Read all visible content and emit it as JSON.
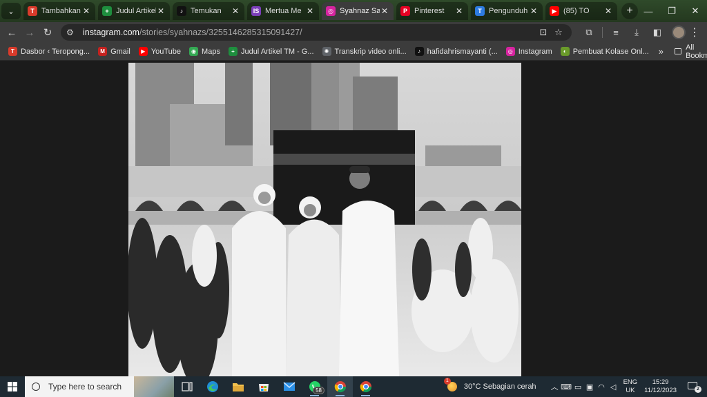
{
  "tabs": [
    {
      "title": "Tambahkan",
      "icon": "teropong-favicon",
      "color": "#d93b2b",
      "glyph": "T",
      "active": false
    },
    {
      "title": "Judul Artikel",
      "icon": "sheets-favicon",
      "color": "#1e8e3e",
      "glyph": "+",
      "active": false
    },
    {
      "title": "Temukan",
      "icon": "tiktok-favicon",
      "color": "#111111",
      "glyph": "♪",
      "active": false
    },
    {
      "title": "Mertua Me",
      "icon": "is-favicon",
      "color": "#7b3fb8",
      "glyph": "IS",
      "active": false
    },
    {
      "title": "Syahnaz Sa",
      "icon": "instagram-favicon",
      "color": "#d6249f",
      "glyph": "◎",
      "active": true
    },
    {
      "title": "Pinterest",
      "icon": "pinterest-favicon",
      "color": "#e60023",
      "glyph": "P",
      "active": false
    },
    {
      "title": "Pengunduh",
      "icon": "downloader-favicon",
      "color": "#2d7be0",
      "glyph": "T",
      "active": false
    },
    {
      "title": "(85) TO",
      "icon": "youtube-favicon",
      "color": "#ff0000",
      "glyph": "▶",
      "active": false
    }
  ],
  "address": {
    "host": "instagram.com",
    "path": "/stories/syahnazs/3255146285315091427/"
  },
  "bookmarks": [
    {
      "label": "Dasbor ‹ Teropong...",
      "icon": "teropong-favicon",
      "color": "#d93b2b",
      "glyph": "T"
    },
    {
      "label": "Gmail",
      "icon": "gmail-favicon",
      "color": "#c5221f",
      "glyph": "M"
    },
    {
      "label": "YouTube",
      "icon": "youtube-favicon",
      "color": "#ff0000",
      "glyph": "▶"
    },
    {
      "label": "Maps",
      "icon": "maps-favicon",
      "color": "#34a853",
      "glyph": "◉"
    },
    {
      "label": "Judul Artikel TM - G...",
      "icon": "sheets-favicon",
      "color": "#1e8e3e",
      "glyph": "+"
    },
    {
      "label": "Transkrip video onli...",
      "icon": "transcript-favicon",
      "color": "#5f6368",
      "glyph": "✺"
    },
    {
      "label": "hafidahrismayanti (...",
      "icon": "tiktok-favicon",
      "color": "#111111",
      "glyph": "♪"
    },
    {
      "label": "Instagram",
      "icon": "instagram-favicon",
      "color": "#d6249f",
      "glyph": "◎"
    },
    {
      "label": "Pembuat Kolase Onl...",
      "icon": "collage-favicon",
      "color": "#6a9a2a",
      "glyph": "◐"
    }
  ],
  "all_bookmarks": "All Bookmarks",
  "taskbar": {
    "search_placeholder": "Type here to search",
    "whatsapp_badge": "58",
    "weather": "30°C  Sebagian cerah",
    "lang_top": "ENG",
    "lang_bottom": "UK",
    "time": "15:29",
    "date": "11/12/2023",
    "notifications": "2"
  }
}
